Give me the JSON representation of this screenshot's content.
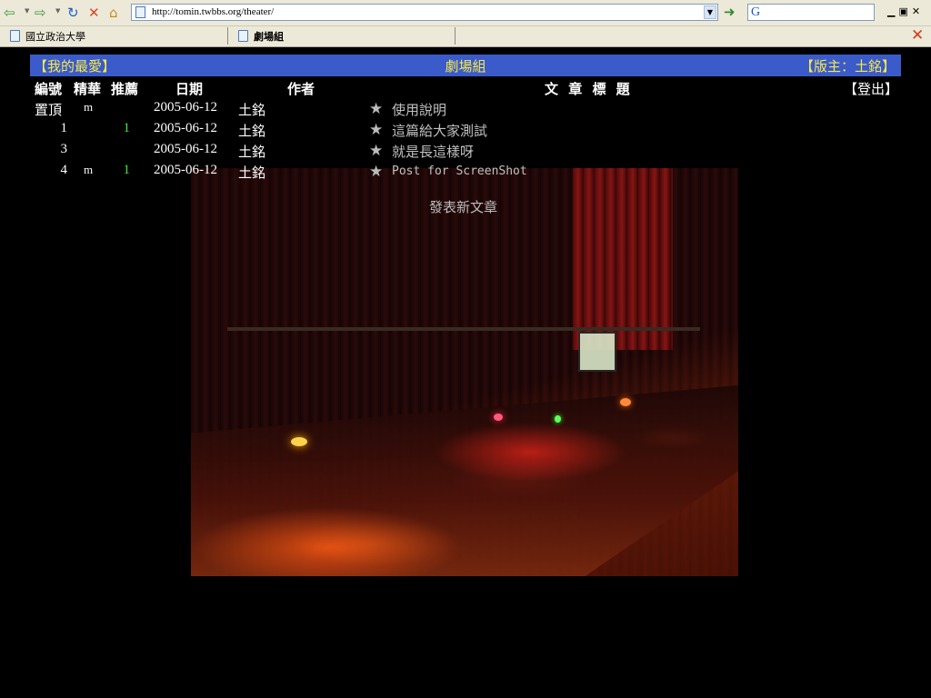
{
  "browser": {
    "address": "http://tomin.twbbs.org/theater/",
    "tabs": [
      {
        "label": "國立政治大學",
        "active": false
      },
      {
        "label": "劇場組",
        "active": true
      }
    ],
    "icons": {
      "back": "back-arrow-icon",
      "forward": "forward-arrow-icon",
      "refresh": "refresh-icon",
      "stop": "stop-icon",
      "home": "home-icon",
      "go": "go-icon",
      "search": "google-search-icon",
      "close_tab": "close-tab-icon"
    }
  },
  "board": {
    "header": {
      "favorites": "【我的最愛】",
      "board_name": "劇場組",
      "moderator": "【版主：土銘】"
    },
    "columns": {
      "number": "編號",
      "digest": "精華",
      "recommend": "推薦",
      "date": "日期",
      "author": "作者",
      "title": "文 章 標 題"
    },
    "logout": "【登出】",
    "articles": [
      {
        "number": "置頂",
        "mark": "m",
        "recommend": "",
        "date": "2005-06-12",
        "author": "土銘",
        "title": "使用說明"
      },
      {
        "number": "1",
        "mark": "",
        "recommend": "1",
        "date": "2005-06-12",
        "author": "土銘",
        "title": "這篇給大家測試"
      },
      {
        "number": "3",
        "mark": "",
        "recommend": "",
        "date": "2005-06-12",
        "author": "土銘",
        "title": "就是長這樣呀"
      },
      {
        "number": "4",
        "mark": "m",
        "recommend": "1",
        "date": "2005-06-12",
        "author": "土銘",
        "title": "Post for ScreenShot"
      }
    ],
    "new_post": "發表新文章"
  },
  "colors": {
    "header_bg": "#3a5bc9",
    "header_text": "#f7e84a",
    "recommend": "#3fe63f",
    "title_text": "#c0c0c0"
  }
}
